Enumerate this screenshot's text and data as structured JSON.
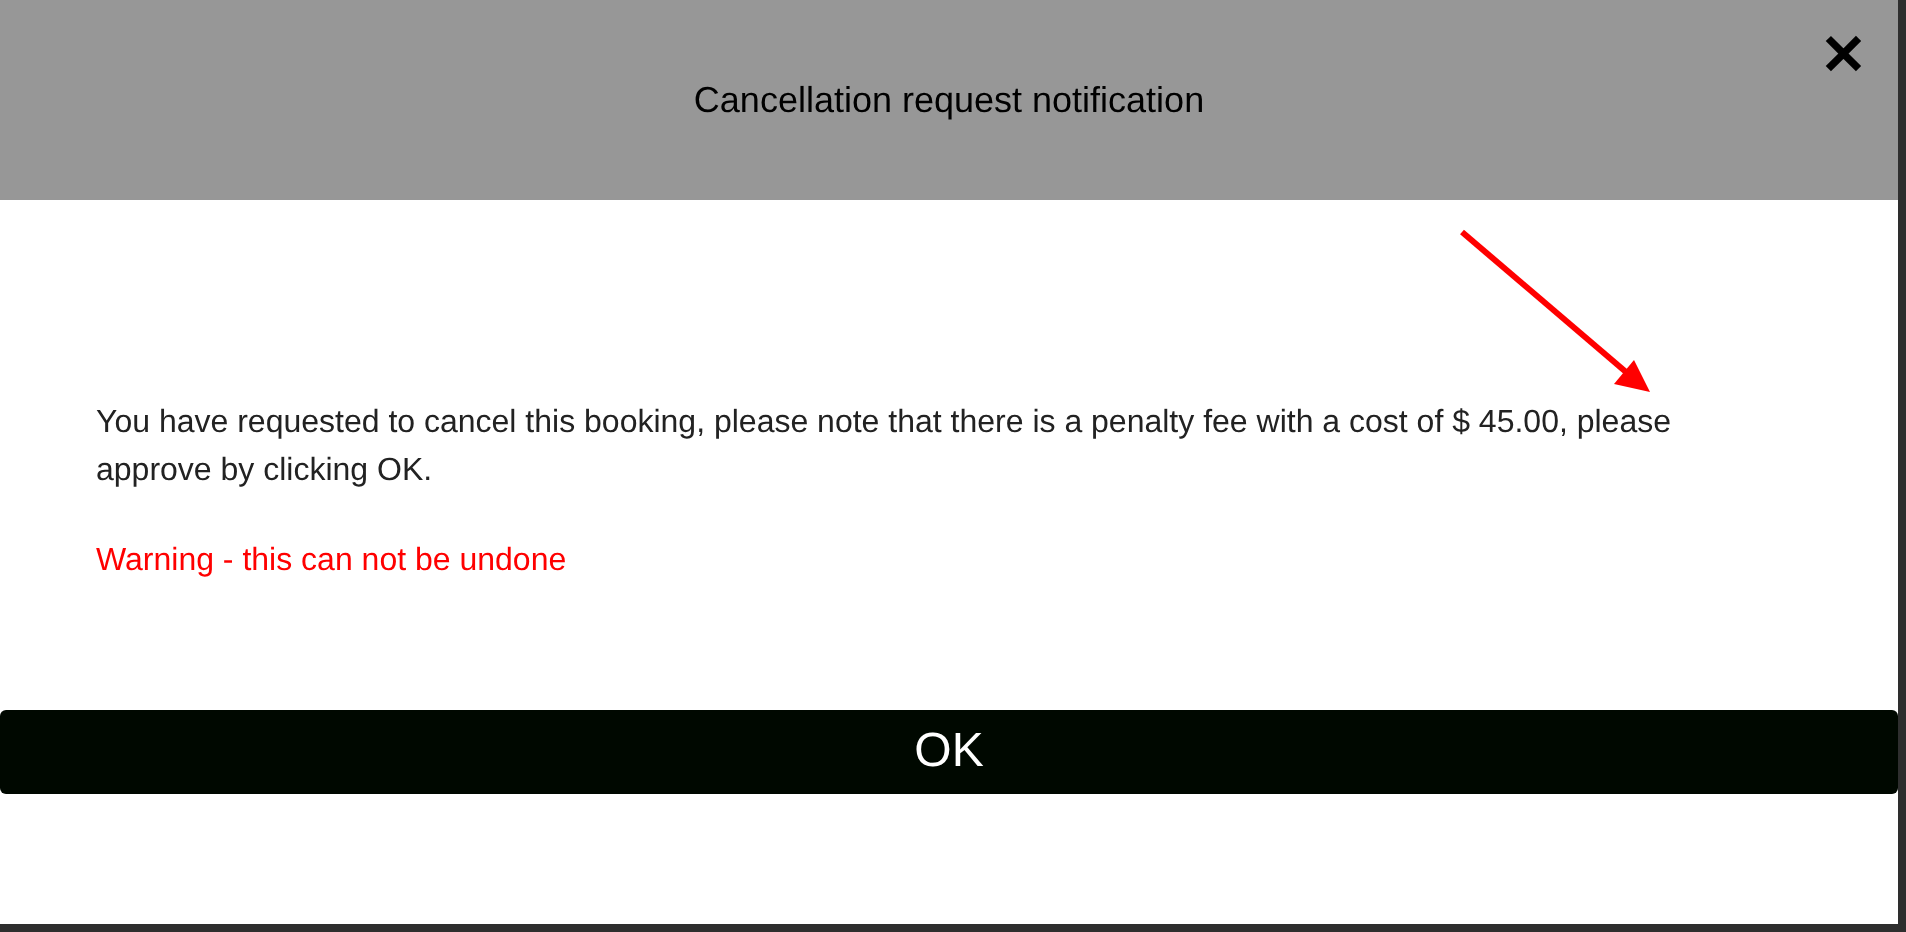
{
  "dialog": {
    "title": "Cancellation request notification",
    "close": "✕",
    "message": "You have requested to cancel this booking, please note that there is a penalty fee with a cost of $ 45.00, please approve by clicking OK.",
    "warning": "Warning - this can not be undone",
    "buttons": [
      "OK"
    ]
  }
}
